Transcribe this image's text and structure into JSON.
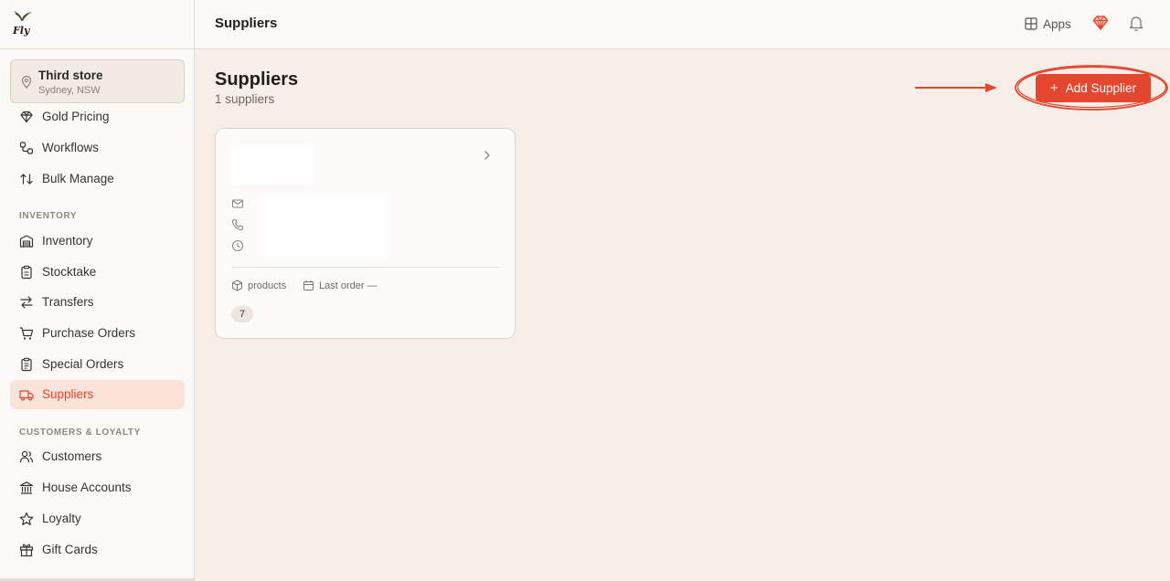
{
  "app": {
    "logo_text": "Fly"
  },
  "store": {
    "name": "Third store",
    "location": "Sydney, NSW"
  },
  "sidebar": {
    "items_top": [
      {
        "label": "Gold Pricing",
        "icon": "gem-icon"
      },
      {
        "label": "Workflows",
        "icon": "workflow-icon"
      },
      {
        "label": "Bulk Manage",
        "icon": "sort-arrows-icon"
      }
    ],
    "inventory_title": "INVENTORY",
    "inventory_items": [
      {
        "label": "Inventory",
        "icon": "warehouse-icon"
      },
      {
        "label": "Stocktake",
        "icon": "clipboard-icon"
      },
      {
        "label": "Transfers",
        "icon": "transfer-icon"
      },
      {
        "label": "Purchase Orders",
        "icon": "cart-icon"
      },
      {
        "label": "Special Orders",
        "icon": "clipboard-list-icon"
      },
      {
        "label": "Suppliers",
        "icon": "truck-icon",
        "active": true
      }
    ],
    "customers_title": "CUSTOMERS & LOYALTY",
    "customer_items": [
      {
        "label": "Customers",
        "icon": "users-icon"
      },
      {
        "label": "House Accounts",
        "icon": "bank-icon"
      },
      {
        "label": "Loyalty",
        "icon": "star-icon"
      },
      {
        "label": "Gift Cards",
        "icon": "gift-icon"
      }
    ]
  },
  "header": {
    "title": "Suppliers",
    "apps_label": "Apps"
  },
  "main": {
    "title": "Suppliers",
    "subtitle": "1 suppliers",
    "add_button_label": "Add Supplier"
  },
  "supplier_card": {
    "products_label": "products",
    "last_order_label": "Last order —",
    "product_count": "7"
  },
  "colors": {
    "accent": "#e4462e",
    "active_bg": "#fbe3d9",
    "page_bg": "#f6eee7"
  }
}
